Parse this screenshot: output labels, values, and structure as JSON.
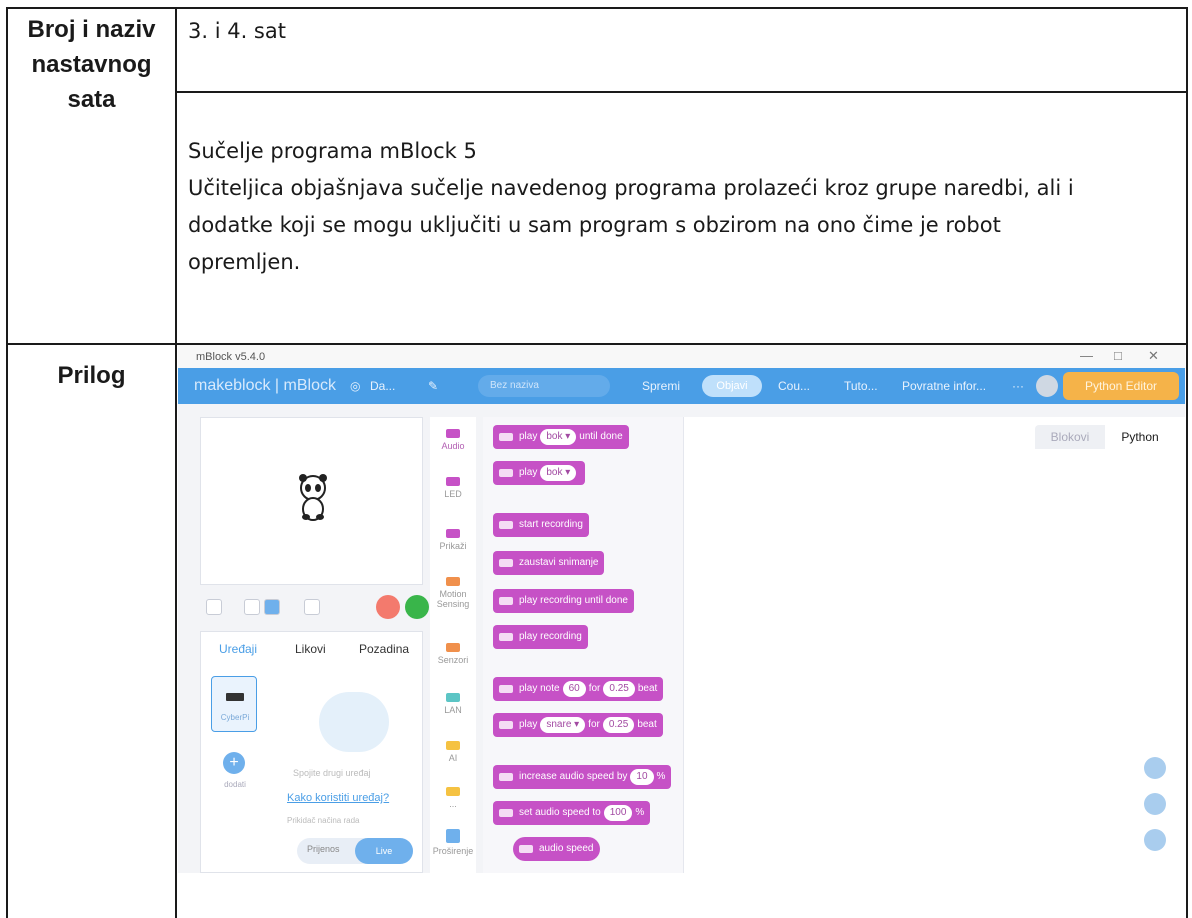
{
  "table": {
    "row1_label": [
      "Broj i naziv",
      "nastavnog",
      "sata"
    ],
    "row1_value": "3. i 4. sat",
    "row2_lines": [
      "Sučelje programa mBlock 5",
      "Učiteljica objašnjava sučelje navedenog programa prolazeći kroz grupe naredbi, ali i",
      "dodatke koji se mogu uključiti u sam program s obzirom na ono čime je robot",
      "opremljen."
    ],
    "row3_label": "Prilog"
  },
  "screenshot": {
    "window_title": "mBlock v5.4.0",
    "window_controls": [
      "—",
      "□",
      "✕"
    ],
    "brand": "makeblock | mBlock",
    "nav": {
      "file": "Da...",
      "project_name": "Bez naziva",
      "save": "Spremi",
      "publish": "Objavi",
      "courses": "Cou...",
      "tutorials": "Tuto...",
      "feedback": "Povratne infor...",
      "more": "···",
      "python_editor": "Python Editor"
    },
    "device_tabs": [
      "Uređaji",
      "Likovi",
      "Pozadina"
    ],
    "device_name": "CyberPi",
    "add_label": "dodati",
    "connect_hint": "Spojite drugi uređaj",
    "help_link": "Kako koristiti uređaj?",
    "mode_label": "Prikidač načina rada",
    "mode_options": [
      "Prijenos",
      "Live"
    ],
    "categories": [
      "Audio",
      "LED",
      "Prikaži",
      "Motion Sensing",
      "Senzori",
      "LAN",
      "AI",
      "...",
      "Proširenje"
    ],
    "blocks": [
      {
        "text": "play",
        "slot": "bok ▾",
        "tail": "until done"
      },
      {
        "text": "play",
        "slot": "bok ▾",
        "tail": ""
      },
      {
        "text": "start recording",
        "slot": "",
        "tail": ""
      },
      {
        "text": "zaustavi snimanje",
        "slot": "",
        "tail": ""
      },
      {
        "text": "play recording until done",
        "slot": "",
        "tail": ""
      },
      {
        "text": "play recording",
        "slot": "",
        "tail": ""
      },
      {
        "text": "play note",
        "slot": "60",
        "tail": "for",
        "slot2": "0.25",
        "tail2": "beat"
      },
      {
        "text": "play",
        "slot": "snare ▾",
        "tail": "for",
        "slot2": "0.25",
        "tail2": "beat"
      },
      {
        "text": "increase audio speed by",
        "slot": "10",
        "tail": "%"
      },
      {
        "text": "set audio speed to",
        "slot": "100",
        "tail": "%"
      },
      {
        "text": "audio speed",
        "slot": "",
        "tail": ""
      }
    ],
    "workspace_tabs": [
      "Blokovi",
      "Python"
    ]
  },
  "colors": {
    "accent": "#4a9ee6",
    "block": "#c651c6",
    "python_button": "#f5b349"
  }
}
